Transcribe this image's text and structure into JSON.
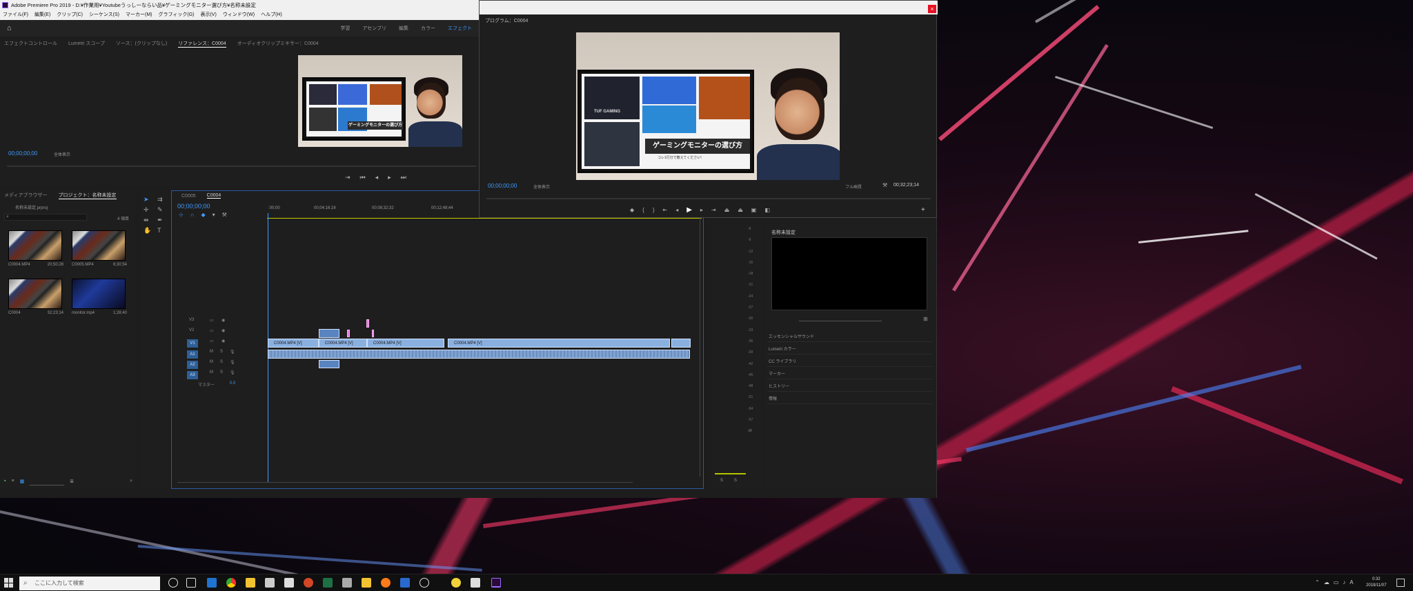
{
  "window": {
    "title": "Adobe Premiere Pro 2019 - D:¥作業用¥Youtubeうっしーならい品¥ゲーミングモニター選び方¥名称未設定"
  },
  "menu": [
    "ファイル(F)",
    "編集(E)",
    "クリップ(C)",
    "シーケンス(S)",
    "マーカー(M)",
    "グラフィック(G)",
    "表示(V)",
    "ウィンドウ(W)",
    "ヘルプ(H)"
  ],
  "workspaces": [
    "学習",
    "アセンブリ",
    "編集",
    "カラー",
    "エフェクト"
  ],
  "source_panel": {
    "tabs": [
      "エフェクトコントロール",
      "Lumetri スコープ",
      "ソース：(クリップなし)",
      "リファレンス：C0004",
      "オーディオクリップミキサー：C0004"
    ],
    "timecode": "00;00;00;00",
    "zoom": "全体表示"
  },
  "program_panel": {
    "title": "プログラム：C0004",
    "timecode": "00;00;00;00",
    "zoom": "全体表示",
    "quality": "フル画質",
    "duration": "00;32;23;14"
  },
  "project_panel": {
    "tabs": [
      "メディアブラウザー",
      "プロジェクト：名称未設定"
    ],
    "project_file": "名称未設定.prproj",
    "item_count": "4 項目",
    "items": [
      {
        "name": "C0004.MP4",
        "duration": "20;50;28"
      },
      {
        "name": "C0005.MP4",
        "duration": "6;30;54"
      },
      {
        "name": "C0004",
        "duration": "32;23;14"
      },
      {
        "name": "monitor.mp4",
        "duration": "1;28;40"
      }
    ]
  },
  "timeline": {
    "tabs": [
      "C0005",
      "C0004"
    ],
    "timecode": "00;00;00;00",
    "ruler": [
      ":00;00",
      "00;04;16;16",
      "00;08;32;32",
      "00;12;48;44"
    ],
    "tracks_video": [
      "V3",
      "V2",
      "V1"
    ],
    "tracks_audio": [
      "A1",
      "A2",
      "A3"
    ],
    "master_label": "マスター",
    "master_value": "0.0",
    "clips": [
      "C0004.MP4 [V]",
      "C0004.MP4 [V]",
      "C0004.MP4 [V]",
      "C0004.MP4 [V]"
    ]
  },
  "right_panel": {
    "title": "名称未設定",
    "sections": [
      "エッセンシャルサウンド",
      "Lumetri カラー",
      "CC ライブラリ",
      "マーカー",
      "ヒストリー",
      "情報"
    ]
  },
  "meter_labels": [
    "-6",
    "-9",
    "-12",
    "-15",
    "-18",
    "-21",
    "-24",
    "-27",
    "-30",
    "-33",
    "-36",
    "-39",
    "-42",
    "-45",
    "-48",
    "-51",
    "-54",
    "-57",
    "dB"
  ],
  "meter_bottom": [
    "S",
    "S"
  ],
  "video_caption": "ゲーミングモニターの選び方",
  "video_caption_sub": "コレ1行分で教えてください!",
  "video_brand": "TUF GAMING",
  "taskbar": {
    "search_placeholder": "ここに入力して検索",
    "time": "0:32",
    "date": "2019/11/07",
    "ime": "A"
  }
}
